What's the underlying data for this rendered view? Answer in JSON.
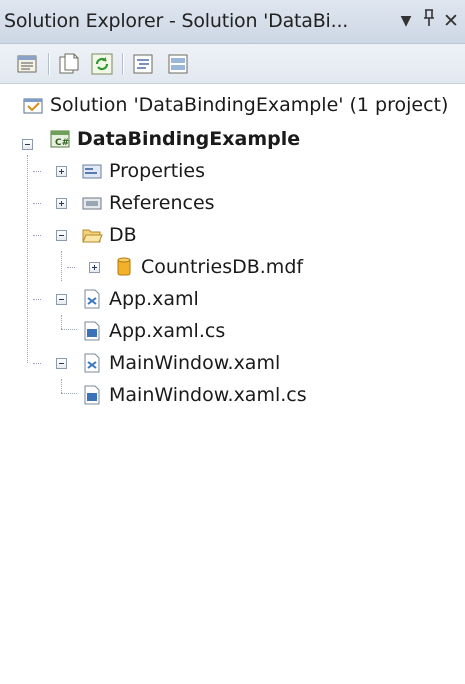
{
  "title_bar": {
    "title": "Solution Explorer - Solution 'DataBi...",
    "dropdown_glyph": "▼",
    "pin_glyph": "ᚹ",
    "close_glyph": "✕"
  },
  "toolbar": {
    "buttons": [
      "properties-icon",
      "show-all-files-icon",
      "refresh-icon",
      "view-code-icon",
      "view-designer-icon"
    ]
  },
  "tree": {
    "solution": "Solution 'DataBindingExample' (1 project)",
    "project": "DataBindingExample",
    "properties": "Properties",
    "references": "References",
    "db": "DB",
    "countries_db": "CountriesDB.mdf",
    "app_xaml": "App.xaml",
    "app_xaml_cs": "App.xaml.cs",
    "main_window": "MainWindow.xaml",
    "main_window_cs": "MainWindow.xaml.cs"
  }
}
